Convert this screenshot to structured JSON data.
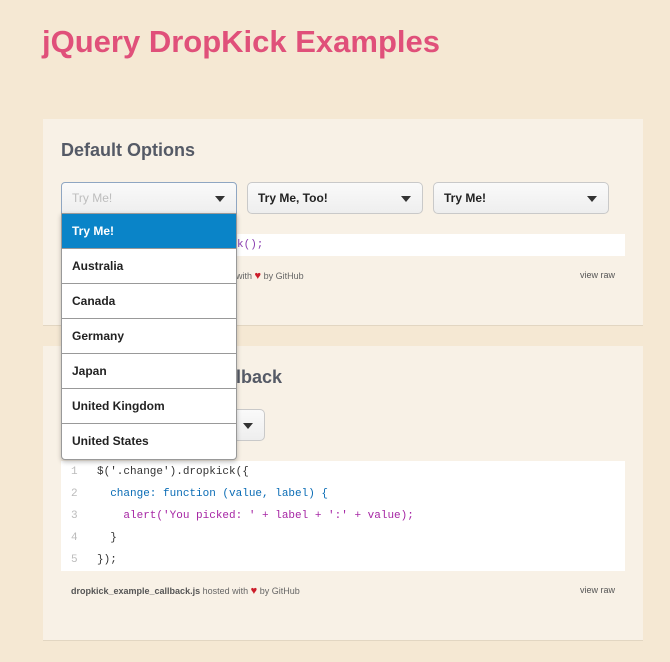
{
  "page": {
    "title": "jQuery DropKick Examples"
  },
  "section1": {
    "heading": "Default Options",
    "selects": [
      {
        "value": "Try Me!"
      },
      {
        "value": "Try Me, Too!"
      },
      {
        "value": "Try Me!"
      }
    ],
    "code_tail": "k();",
    "meta_left_visible": "with",
    "meta_by": "by GitHub",
    "view_raw": "view raw"
  },
  "dropdown": {
    "options": [
      "Try Me!",
      "Australia",
      "Canada",
      "Germany",
      "Japan",
      "United Kingdom",
      "United States"
    ],
    "selected_index": 0
  },
  "section2": {
    "heading_visible": "lback",
    "code": [
      {
        "n": "1",
        "text": "$('.change').dropkick({"
      },
      {
        "n": "2",
        "text": "  change: function (value, label) {"
      },
      {
        "n": "3",
        "text": "    alert('You picked: ' + label + ':' + value);"
      },
      {
        "n": "4",
        "text": "  }"
      },
      {
        "n": "5",
        "text": "});"
      }
    ],
    "meta_file": "dropkick_example_callback.js",
    "meta_hosted": "hosted with",
    "meta_by": "by GitHub",
    "view_raw": "view raw"
  },
  "colors": {
    "title": "#e0507a",
    "selected": "#0a84c8",
    "heart": "#cc1d2a"
  }
}
